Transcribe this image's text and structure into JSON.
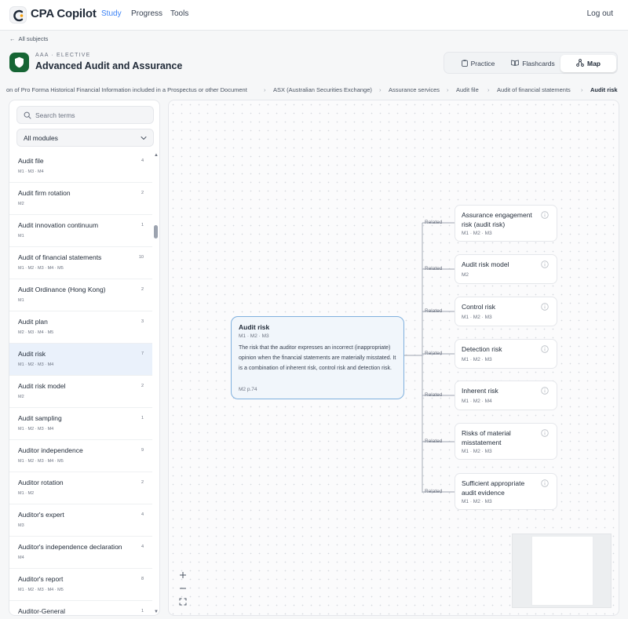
{
  "app": {
    "title": "CPA Copilot",
    "nav": [
      "Study",
      "Progress",
      "Tools"
    ],
    "logout": "Log out"
  },
  "subject": {
    "back": "All subjects",
    "kicker": "AAA · ELECTIVE",
    "title": "Advanced Audit and Assurance",
    "views": [
      "Practice",
      "Flashcards",
      "Map"
    ],
    "active_view": "Map"
  },
  "breadcrumb": [
    "on of Pro Forma Historical Financial Information included in a Prospectus or other Document",
    "ASX (Australian Securities Exchange)",
    "Assurance services",
    "Audit file",
    "Audit of financial statements",
    "Audit risk"
  ],
  "sidebar": {
    "search_placeholder": "Search terms",
    "module_filter": "All modules",
    "terms": [
      {
        "name": "Audit file",
        "modules": "M1 · M3 · M4",
        "count": "4"
      },
      {
        "name": "Audit firm rotation",
        "modules": "M2",
        "count": "2"
      },
      {
        "name": "Audit innovation continuum",
        "modules": "M1",
        "count": "1"
      },
      {
        "name": "Audit of financial statements",
        "modules": "M1 · M2 · M3 · M4 · M5",
        "count": "10"
      },
      {
        "name": "Audit Ordinance (Hong Kong)",
        "modules": "M1",
        "count": "2"
      },
      {
        "name": "Audit plan",
        "modules": "M2 · M3 · M4 · M5",
        "count": "3"
      },
      {
        "name": "Audit risk",
        "modules": "M1 · M2 · M3 · M4",
        "count": "7",
        "selected": true
      },
      {
        "name": "Audit risk model",
        "modules": "M2",
        "count": "2"
      },
      {
        "name": "Audit sampling",
        "modules": "M1 · M2 · M3 · M4",
        "count": "1"
      },
      {
        "name": "Auditor independence",
        "modules": "M1 · M2 · M3 · M4 · M5",
        "count": "9"
      },
      {
        "name": "Auditor rotation",
        "modules": "M1 · M2",
        "count": "2"
      },
      {
        "name": "Auditor's expert",
        "modules": "M3",
        "count": "4"
      },
      {
        "name": "Auditor's independence declaration",
        "modules": "M4",
        "count": "4"
      },
      {
        "name": "Auditor's report",
        "modules": "M1 · M2 · M3 · M4 · M5",
        "count": "8"
      },
      {
        "name": "Auditor-General",
        "modules": "",
        "count": "1"
      }
    ]
  },
  "map": {
    "center": {
      "title": "Audit risk",
      "modules": "M1 · M2 · M3",
      "definition": "The risk that the auditor expresses an incorrect (inappropriate) opinion when the financial statements are materially misstated. It is a combination of inherent risk, control risk and detection risk.",
      "ref": "M2 p.74"
    },
    "relation_label": "Related",
    "related": [
      {
        "title": "Assurance engagement risk (audit risk)",
        "modules": "M1 · M2 · M3"
      },
      {
        "title": "Audit risk model",
        "modules": "M2"
      },
      {
        "title": "Control risk",
        "modules": "M1 · M2 · M3"
      },
      {
        "title": "Detection risk",
        "modules": "M1 · M2 · M3"
      },
      {
        "title": "Inherent risk",
        "modules": "M1 · M2 · M4"
      },
      {
        "title": "Risks of material misstatement",
        "modules": "M1 · M2 · M3"
      },
      {
        "title": "Sufficient appropriate audit evidence",
        "modules": "M1 · M2 · M3"
      }
    ]
  },
  "colors": {
    "accent": "#3b82f6",
    "subject_icon": "#166534",
    "selected_row": "#eaf1fb",
    "center_border": "#7fb0de"
  },
  "icons": {
    "logo": "cpa-logo-icon",
    "back": "arrow-left-icon",
    "subject": "shield-icon",
    "practice": "clipboard-icon",
    "flashcards": "book-open-icon",
    "map": "network-icon",
    "search": "search-icon",
    "select": "chevron-down-icon",
    "info": "info-icon",
    "zoom_in": "plus-icon",
    "zoom_out": "minus-icon",
    "fit": "fit-view-icon"
  }
}
